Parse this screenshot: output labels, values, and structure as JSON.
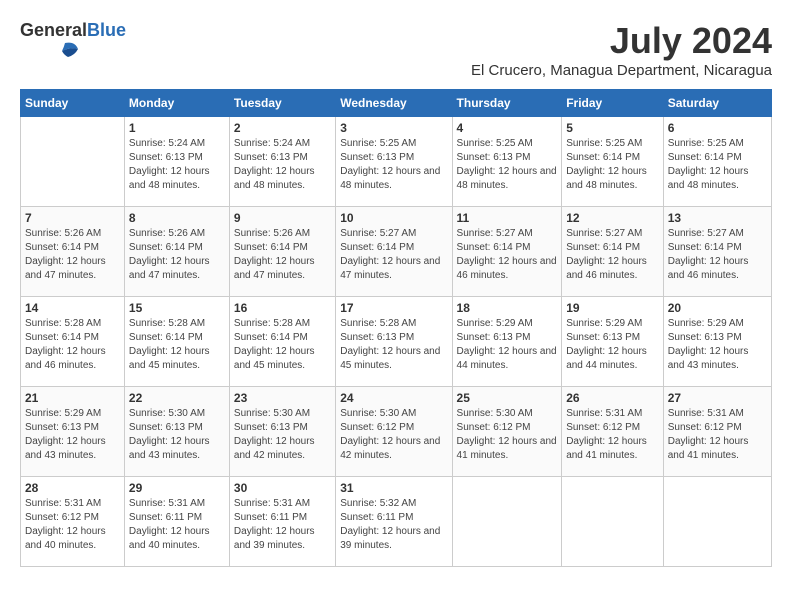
{
  "header": {
    "logo_general": "General",
    "logo_blue": "Blue",
    "month_year": "July 2024",
    "location": "El Crucero, Managua Department, Nicaragua"
  },
  "weekdays": [
    "Sunday",
    "Monday",
    "Tuesday",
    "Wednesday",
    "Thursday",
    "Friday",
    "Saturday"
  ],
  "weeks": [
    [
      {
        "day": "",
        "sunrise": "",
        "sunset": "",
        "daylight": ""
      },
      {
        "day": "1",
        "sunrise": "Sunrise: 5:24 AM",
        "sunset": "Sunset: 6:13 PM",
        "daylight": "Daylight: 12 hours and 48 minutes."
      },
      {
        "day": "2",
        "sunrise": "Sunrise: 5:24 AM",
        "sunset": "Sunset: 6:13 PM",
        "daylight": "Daylight: 12 hours and 48 minutes."
      },
      {
        "day": "3",
        "sunrise": "Sunrise: 5:25 AM",
        "sunset": "Sunset: 6:13 PM",
        "daylight": "Daylight: 12 hours and 48 minutes."
      },
      {
        "day": "4",
        "sunrise": "Sunrise: 5:25 AM",
        "sunset": "Sunset: 6:13 PM",
        "daylight": "Daylight: 12 hours and 48 minutes."
      },
      {
        "day": "5",
        "sunrise": "Sunrise: 5:25 AM",
        "sunset": "Sunset: 6:14 PM",
        "daylight": "Daylight: 12 hours and 48 minutes."
      },
      {
        "day": "6",
        "sunrise": "Sunrise: 5:25 AM",
        "sunset": "Sunset: 6:14 PM",
        "daylight": "Daylight: 12 hours and 48 minutes."
      }
    ],
    [
      {
        "day": "7",
        "sunrise": "Sunrise: 5:26 AM",
        "sunset": "Sunset: 6:14 PM",
        "daylight": "Daylight: 12 hours and 47 minutes."
      },
      {
        "day": "8",
        "sunrise": "Sunrise: 5:26 AM",
        "sunset": "Sunset: 6:14 PM",
        "daylight": "Daylight: 12 hours and 47 minutes."
      },
      {
        "day": "9",
        "sunrise": "Sunrise: 5:26 AM",
        "sunset": "Sunset: 6:14 PM",
        "daylight": "Daylight: 12 hours and 47 minutes."
      },
      {
        "day": "10",
        "sunrise": "Sunrise: 5:27 AM",
        "sunset": "Sunset: 6:14 PM",
        "daylight": "Daylight: 12 hours and 47 minutes."
      },
      {
        "day": "11",
        "sunrise": "Sunrise: 5:27 AM",
        "sunset": "Sunset: 6:14 PM",
        "daylight": "Daylight: 12 hours and 46 minutes."
      },
      {
        "day": "12",
        "sunrise": "Sunrise: 5:27 AM",
        "sunset": "Sunset: 6:14 PM",
        "daylight": "Daylight: 12 hours and 46 minutes."
      },
      {
        "day": "13",
        "sunrise": "Sunrise: 5:27 AM",
        "sunset": "Sunset: 6:14 PM",
        "daylight": "Daylight: 12 hours and 46 minutes."
      }
    ],
    [
      {
        "day": "14",
        "sunrise": "Sunrise: 5:28 AM",
        "sunset": "Sunset: 6:14 PM",
        "daylight": "Daylight: 12 hours and 46 minutes."
      },
      {
        "day": "15",
        "sunrise": "Sunrise: 5:28 AM",
        "sunset": "Sunset: 6:14 PM",
        "daylight": "Daylight: 12 hours and 45 minutes."
      },
      {
        "day": "16",
        "sunrise": "Sunrise: 5:28 AM",
        "sunset": "Sunset: 6:14 PM",
        "daylight": "Daylight: 12 hours and 45 minutes."
      },
      {
        "day": "17",
        "sunrise": "Sunrise: 5:28 AM",
        "sunset": "Sunset: 6:13 PM",
        "daylight": "Daylight: 12 hours and 45 minutes."
      },
      {
        "day": "18",
        "sunrise": "Sunrise: 5:29 AM",
        "sunset": "Sunset: 6:13 PM",
        "daylight": "Daylight: 12 hours and 44 minutes."
      },
      {
        "day": "19",
        "sunrise": "Sunrise: 5:29 AM",
        "sunset": "Sunset: 6:13 PM",
        "daylight": "Daylight: 12 hours and 44 minutes."
      },
      {
        "day": "20",
        "sunrise": "Sunrise: 5:29 AM",
        "sunset": "Sunset: 6:13 PM",
        "daylight": "Daylight: 12 hours and 43 minutes."
      }
    ],
    [
      {
        "day": "21",
        "sunrise": "Sunrise: 5:29 AM",
        "sunset": "Sunset: 6:13 PM",
        "daylight": "Daylight: 12 hours and 43 minutes."
      },
      {
        "day": "22",
        "sunrise": "Sunrise: 5:30 AM",
        "sunset": "Sunset: 6:13 PM",
        "daylight": "Daylight: 12 hours and 43 minutes."
      },
      {
        "day": "23",
        "sunrise": "Sunrise: 5:30 AM",
        "sunset": "Sunset: 6:13 PM",
        "daylight": "Daylight: 12 hours and 42 minutes."
      },
      {
        "day": "24",
        "sunrise": "Sunrise: 5:30 AM",
        "sunset": "Sunset: 6:12 PM",
        "daylight": "Daylight: 12 hours and 42 minutes."
      },
      {
        "day": "25",
        "sunrise": "Sunrise: 5:30 AM",
        "sunset": "Sunset: 6:12 PM",
        "daylight": "Daylight: 12 hours and 41 minutes."
      },
      {
        "day": "26",
        "sunrise": "Sunrise: 5:31 AM",
        "sunset": "Sunset: 6:12 PM",
        "daylight": "Daylight: 12 hours and 41 minutes."
      },
      {
        "day": "27",
        "sunrise": "Sunrise: 5:31 AM",
        "sunset": "Sunset: 6:12 PM",
        "daylight": "Daylight: 12 hours and 41 minutes."
      }
    ],
    [
      {
        "day": "28",
        "sunrise": "Sunrise: 5:31 AM",
        "sunset": "Sunset: 6:12 PM",
        "daylight": "Daylight: 12 hours and 40 minutes."
      },
      {
        "day": "29",
        "sunrise": "Sunrise: 5:31 AM",
        "sunset": "Sunset: 6:11 PM",
        "daylight": "Daylight: 12 hours and 40 minutes."
      },
      {
        "day": "30",
        "sunrise": "Sunrise: 5:31 AM",
        "sunset": "Sunset: 6:11 PM",
        "daylight": "Daylight: 12 hours and 39 minutes."
      },
      {
        "day": "31",
        "sunrise": "Sunrise: 5:32 AM",
        "sunset": "Sunset: 6:11 PM",
        "daylight": "Daylight: 12 hours and 39 minutes."
      },
      {
        "day": "",
        "sunrise": "",
        "sunset": "",
        "daylight": ""
      },
      {
        "day": "",
        "sunrise": "",
        "sunset": "",
        "daylight": ""
      },
      {
        "day": "",
        "sunrise": "",
        "sunset": "",
        "daylight": ""
      }
    ]
  ]
}
